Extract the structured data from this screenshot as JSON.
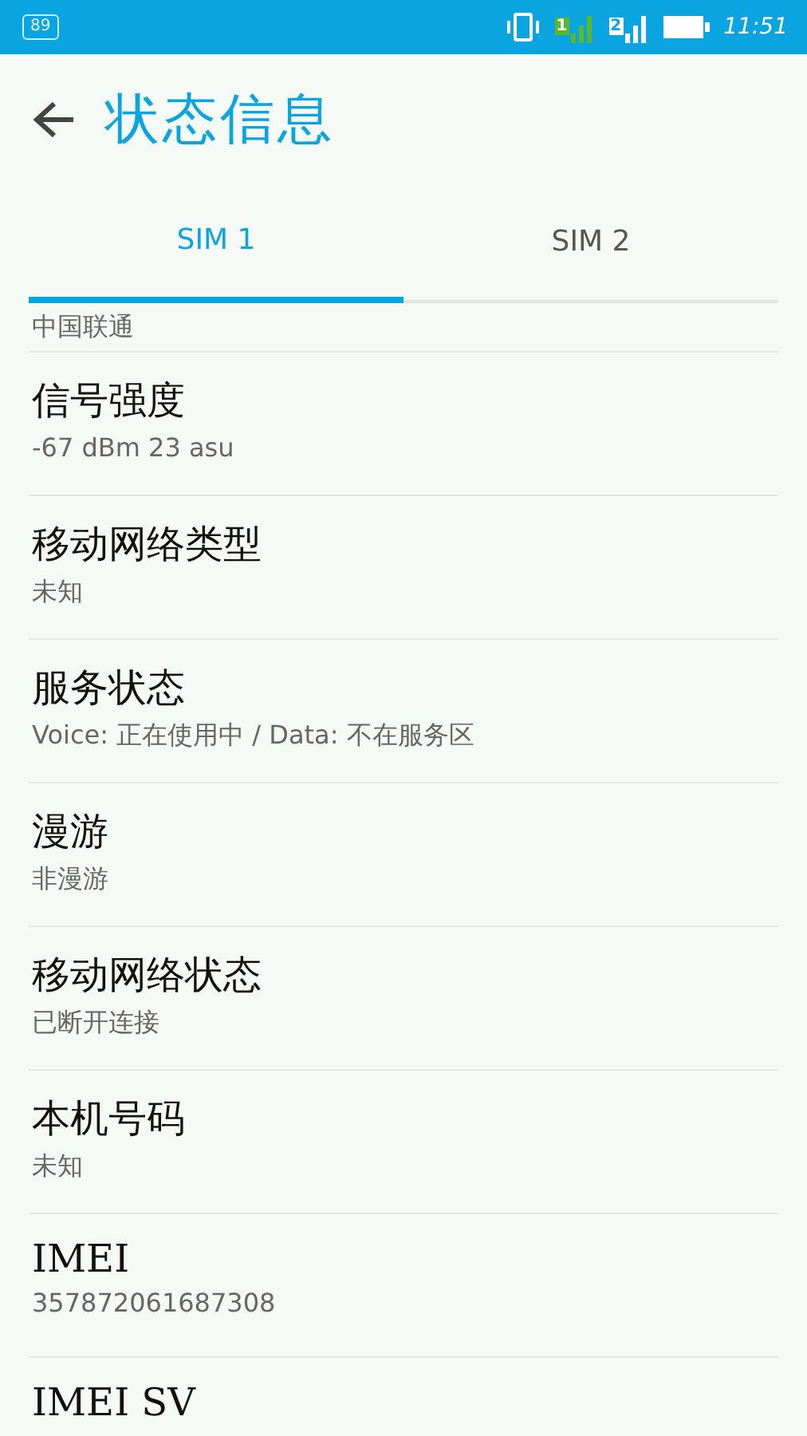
{
  "status_bar": {
    "notification_count": "89",
    "sim1_label": "1",
    "sim2_label": "2",
    "time": "11:51"
  },
  "header": {
    "title": "状态信息"
  },
  "tabs": [
    {
      "label": "SIM 1",
      "selected": true
    },
    {
      "label": "SIM 2",
      "selected": false
    }
  ],
  "items": [
    {
      "summary": "中国联通"
    },
    {
      "title": "信号强度",
      "summary": "-67 dBm   23 asu"
    },
    {
      "title": "移动网络类型",
      "summary": "未知"
    },
    {
      "title": "服务状态",
      "summary": "Voice: 正在使用中 / Data: 不在服务区"
    },
    {
      "title": "漫游",
      "summary": "非漫游"
    },
    {
      "title": "移动网络状态",
      "summary": "已断开连接"
    },
    {
      "title": "本机号码",
      "summary": "未知"
    },
    {
      "title": "IMEI",
      "summary": "357872061687308"
    },
    {
      "title": "IMEI SV"
    }
  ]
}
